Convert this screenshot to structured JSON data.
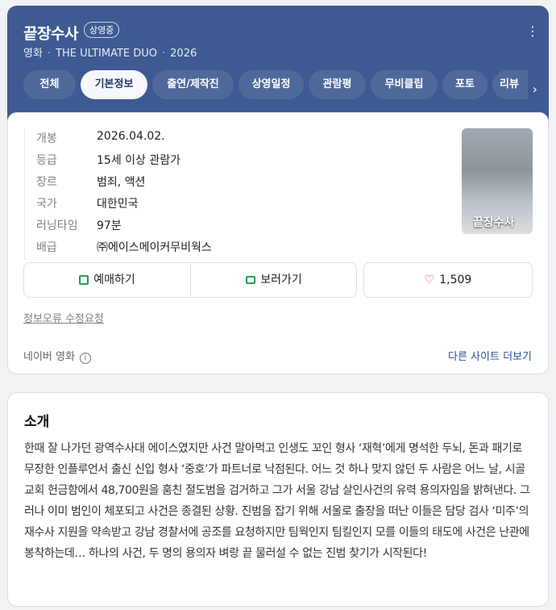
{
  "header": {
    "title": "끝장수사",
    "badge": "상영중",
    "meta": [
      "영화",
      "THE ULTIMATE DUO",
      "2026"
    ],
    "menu_icon": "more-vertical-icon"
  },
  "tabs": [
    {
      "label": "전체",
      "active": false
    },
    {
      "label": "기본정보",
      "active": true
    },
    {
      "label": "출연/제작진",
      "active": false
    },
    {
      "label": "상영일정",
      "active": false
    },
    {
      "label": "관람평",
      "active": false
    },
    {
      "label": "무비클립",
      "active": false
    },
    {
      "label": "포토",
      "active": false
    },
    {
      "label": "리뷰",
      "active": false
    }
  ],
  "info": [
    {
      "label": "개봉",
      "value": "2026.04.02."
    },
    {
      "label": "등급",
      "value": "15세 이상 관람가"
    },
    {
      "label": "장르",
      "value": "범죄, 액션"
    },
    {
      "label": "국가",
      "value": "대한민국"
    },
    {
      "label": "러닝타임",
      "value": "97분"
    },
    {
      "label": "배급",
      "value": "㈜에이스메이커무비웍스"
    }
  ],
  "poster": {
    "title": "끝장수사"
  },
  "actions": {
    "reserve_label": "예매하기",
    "watch_label": "보러가기",
    "like_count": "1,509"
  },
  "footer": {
    "error_link": "정보오류 수정요청",
    "source": "네이버 영화",
    "more_sites": "다른 사이트 더보기"
  },
  "intro": {
    "title": "소개",
    "text": "한때 잘 나가던 광역수사대 에이스였지만 사건 말아먹고 인생도 꼬인 형사 ‘재혁’에게 명석한 두뇌, 돈과 패기로 무장한 인플루언서 출신 신입 형사 ‘중호’가 파트너로 낙점된다. 어느 것 하나 맞지 않던 두 사람은 어느 날, 시골 교회 헌금함에서 48,700원을 훔친 절도범을 검거하고 그가 서울 강남 살인사건의 유력 용의자임을 밝혀낸다. 그러나 이미 범인이 체포되고 사건은 종결된 상황. 진범을 잡기 위해 서울로 출장을 떠난 이들은 담당 검사 ‘미주’의 재수사 지원을 약속받고 강남 경찰서에 공조를 요청하지만 팀웍인지 팀킬인지 모를 이들의 태도에 사건은 난관에 봉착하는데… 하나의 사건, 두 명의 용의자 벼랑 끝 물러설 수 없는 진범 찾기가 시작된다!"
  },
  "colors": {
    "header_bg": "#3d5a92",
    "link": "#254f9a",
    "heart": "#e1384b",
    "reserve_icon": "#1f9e5a"
  }
}
